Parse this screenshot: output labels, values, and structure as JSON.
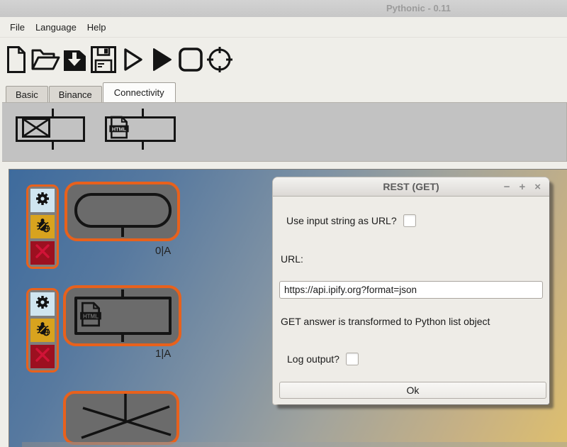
{
  "window": {
    "title": "Pythonic - 0.11"
  },
  "menu": {
    "items": [
      {
        "label": "File"
      },
      {
        "label": "Language"
      },
      {
        "label": "Help"
      }
    ]
  },
  "toolbar": {
    "buttons": [
      {
        "name": "new-file"
      },
      {
        "name": "open-file"
      },
      {
        "name": "save-as"
      },
      {
        "name": "save"
      },
      {
        "name": "run-once"
      },
      {
        "name": "run-all"
      },
      {
        "name": "stop"
      },
      {
        "name": "schedule"
      }
    ]
  },
  "tabs": [
    {
      "label": "Basic",
      "active": false
    },
    {
      "label": "Binance",
      "active": false
    },
    {
      "label": "Connectivity",
      "active": true
    }
  ],
  "palette": {
    "items": [
      {
        "name": "email"
      },
      {
        "name": "rest-get"
      }
    ]
  },
  "icons": {
    "html_text": "HTML"
  },
  "canvas": {
    "nodes": [
      {
        "label": "0|A",
        "type": "start"
      },
      {
        "label": "1|A",
        "type": "rest-get"
      },
      {
        "label": "",
        "type": "multi-branch"
      }
    ]
  },
  "dialog": {
    "title": "REST (GET)",
    "window_controls": {
      "minimize": "−",
      "maximize": "+",
      "close": "×"
    },
    "use_input_label": "Use input string as URL?",
    "use_input_checked": false,
    "url_label": "URL:",
    "url_value": "https://api.ipify.org?format=json",
    "info_text": "GET answer is transformed to Python list object",
    "log_label": "Log output?",
    "log_checked": false,
    "ok_label": "Ok"
  },
  "colors": {
    "accent_orange": "#E8611C",
    "node_gray": "#6B6B6B",
    "gear_bg": "#CFE5F0",
    "debug_bg": "#D8A31E",
    "delete_bg": "#9C1020",
    "delete_x": "#D11337",
    "canvas_top": "#3D6B9E",
    "canvas_bottom": "#DEBF6E"
  }
}
